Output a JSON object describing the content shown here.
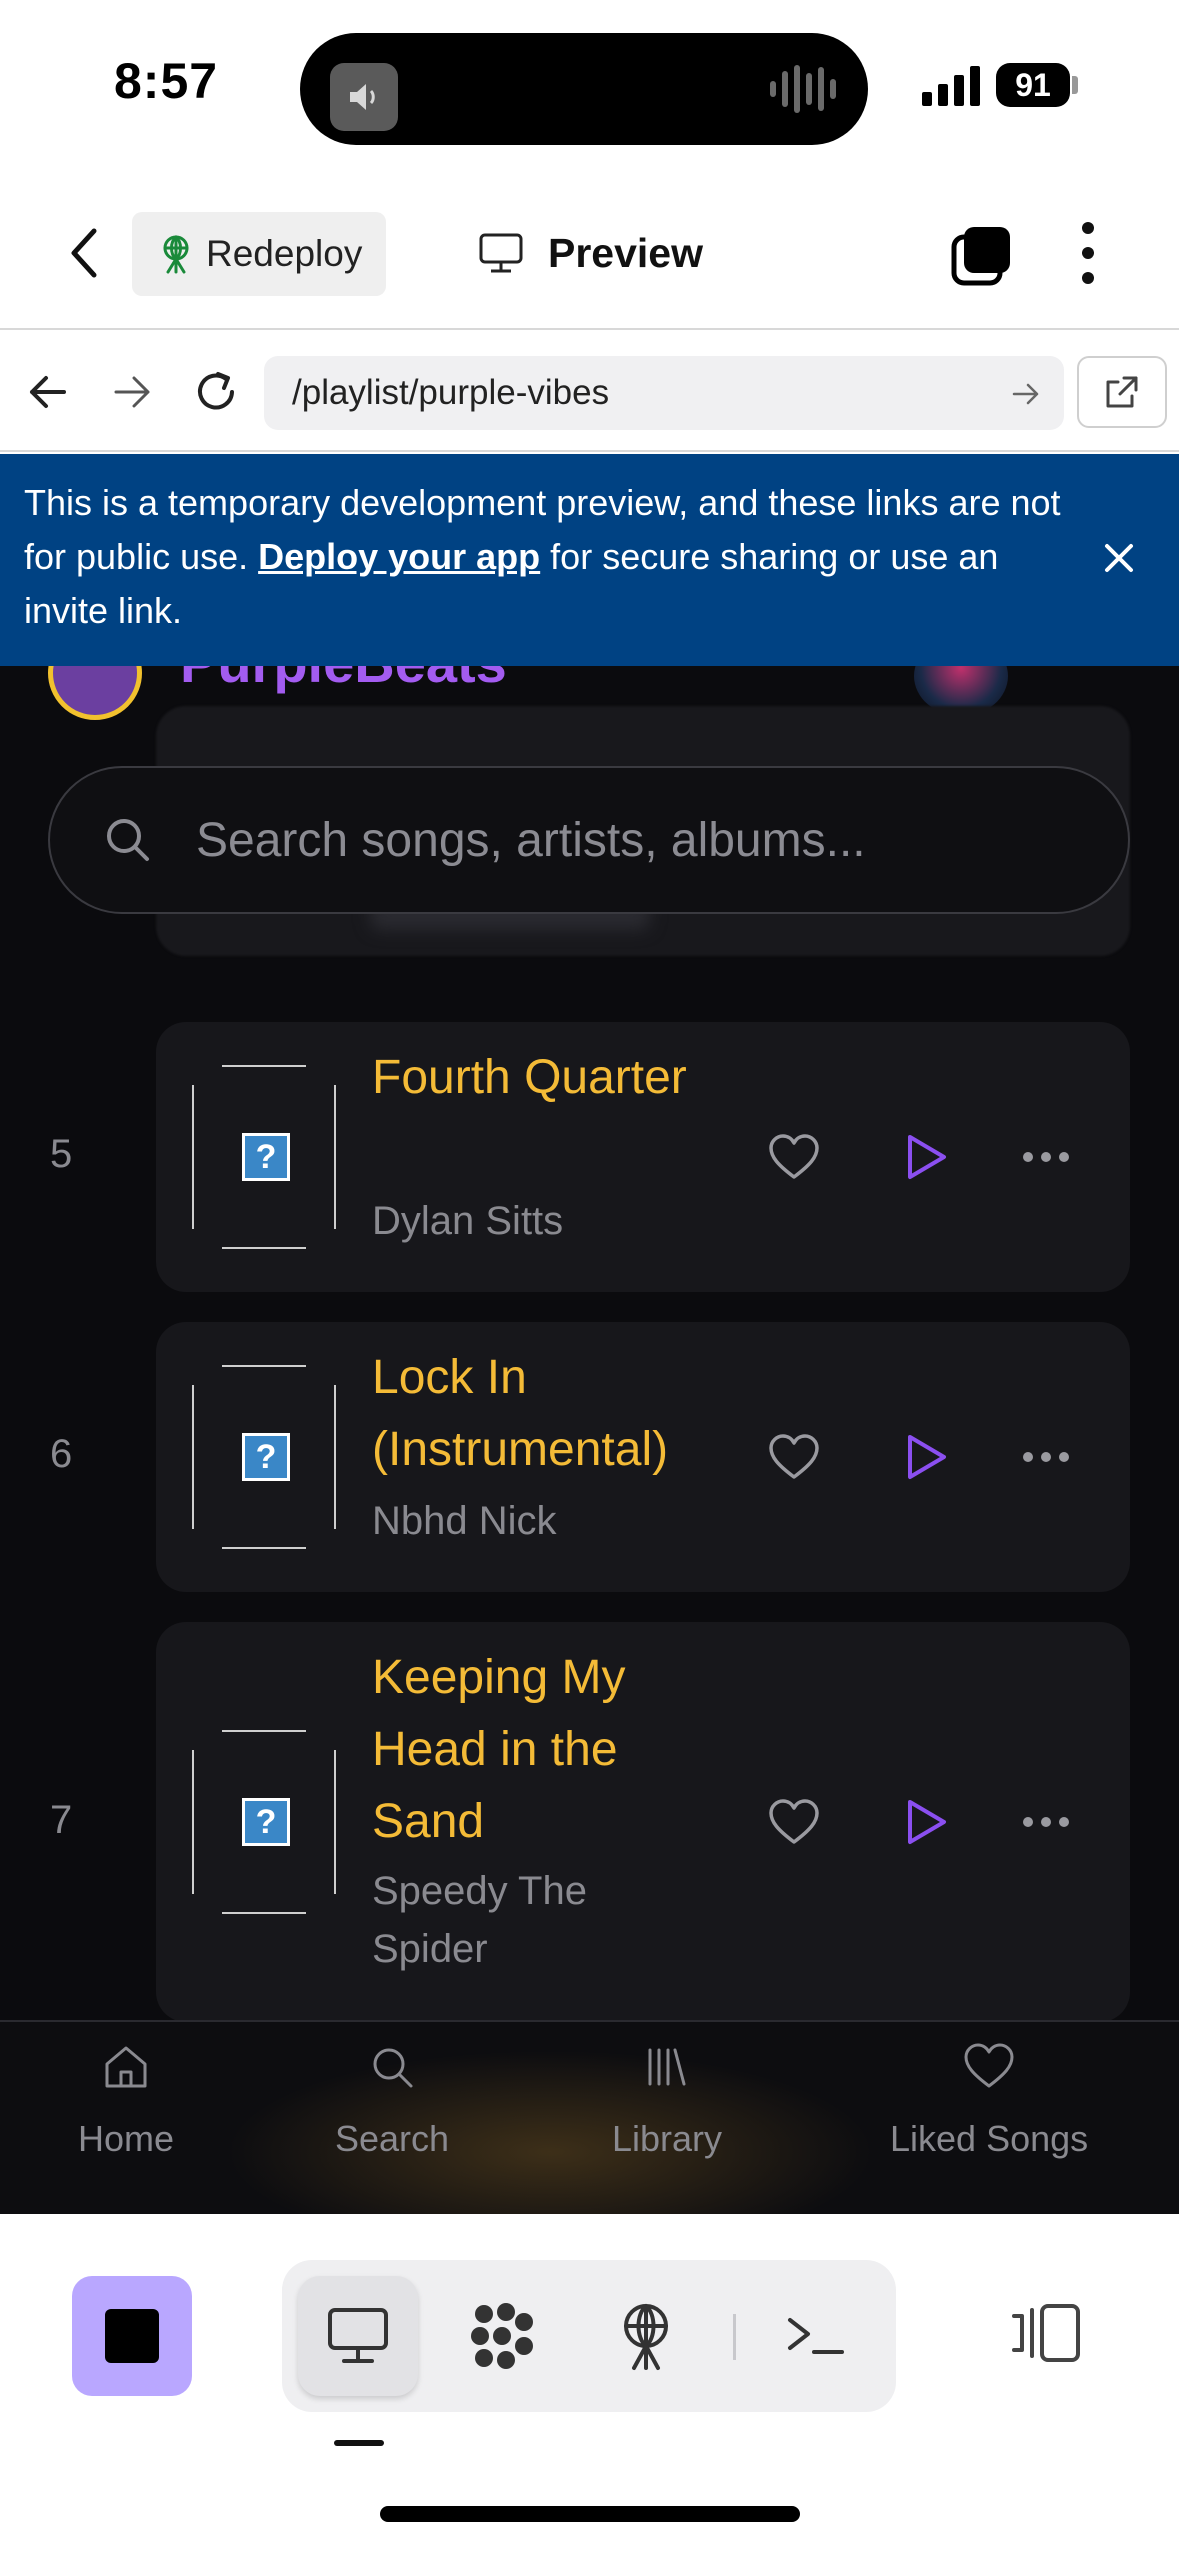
{
  "status_bar": {
    "time": "8:57",
    "battery": "91"
  },
  "app_bar": {
    "redeploy_label": "Redeploy",
    "preview_label": "Preview"
  },
  "browser": {
    "url": "/playlist/purple-vibes"
  },
  "banner": {
    "text_before": "This is a temporary development preview, and these links are not for public use. ",
    "link_text": "Deploy your app",
    "text_after": " for secure sharing or use an invite link."
  },
  "app": {
    "brand": "PurpleBeats",
    "search_placeholder": "Search songs, artists, albums...",
    "tracks": [
      {
        "number": "5",
        "title": "Fourth Quarter",
        "artist": "Dylan Sitts",
        "cover_glyph": "?"
      },
      {
        "number": "6",
        "title": "Lock In (Instrumental)",
        "artist": "Nbhd Nick",
        "cover_glyph": "?"
      },
      {
        "number": "7",
        "title": "Keeping My Head in the Sand",
        "artist": "Speedy The Spider",
        "cover_glyph": "?"
      }
    ],
    "nav": [
      {
        "label": "Home",
        "icon": "home-icon"
      },
      {
        "label": "Search",
        "icon": "search-icon"
      },
      {
        "label": "Library",
        "icon": "library-icon"
      },
      {
        "label": "Liked Songs",
        "icon": "heart-icon"
      }
    ]
  },
  "colors": {
    "accent_gold": "#f4bb37",
    "brand_purple": "#a35cf0",
    "banner_blue": "#004283",
    "stop_button": "#b9a7ff"
  }
}
